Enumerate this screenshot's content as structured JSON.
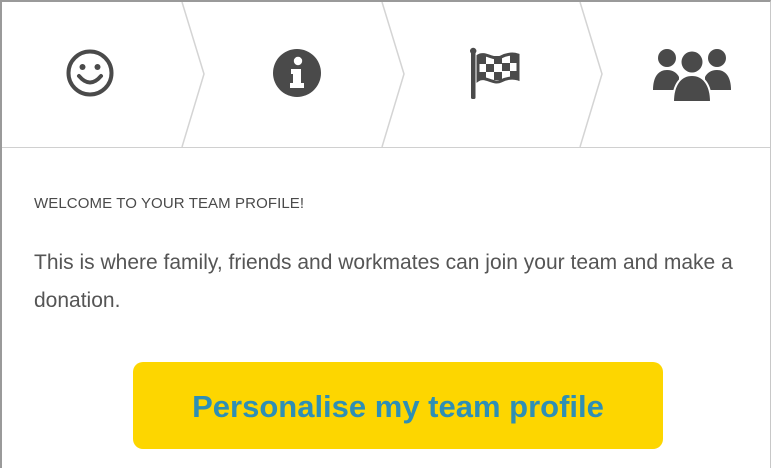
{
  "steps": [
    {
      "name": "Welcome",
      "icon": "smiley-icon"
    },
    {
      "name": "Info",
      "icon": "info-icon"
    },
    {
      "name": "Goal",
      "icon": "checkered-flag-icon"
    },
    {
      "name": "Team",
      "icon": "team-icon"
    }
  ],
  "welcome": {
    "heading": "WELCOME TO YOUR TEAM PROFILE!",
    "body": "This is where family, friends and workmates can join your team and make a donation.",
    "cta_label": "Personalise my team profile"
  },
  "colors": {
    "icon": "#4a4a4a",
    "cta_background": "#fdd600",
    "cta_text": "#2e8fb5",
    "divider": "#d0d0d0"
  }
}
